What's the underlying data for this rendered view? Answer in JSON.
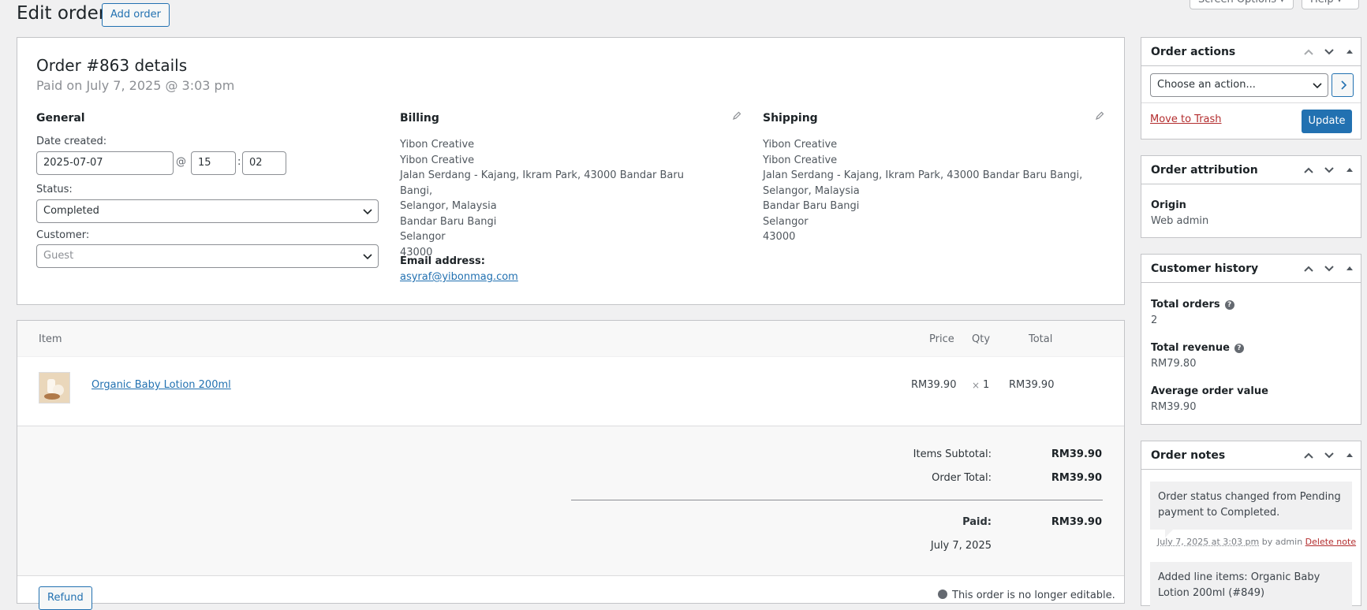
{
  "header": {
    "title": "Edit order",
    "add_order": "Add order",
    "screen_options": "Screen Options ▾",
    "help": "Help ▾"
  },
  "order": {
    "heading": "Order #863 details",
    "paid_on": "Paid on July 7, 2025 @ 3:03 pm",
    "general": {
      "title": "General",
      "date_label": "Date created:",
      "date_value": "2025-07-07",
      "at": "@",
      "hour": "15",
      "colon": ":",
      "minute": "02",
      "status_label": "Status:",
      "status_value": "Completed",
      "customer_label": "Customer:",
      "customer_value": "Guest"
    },
    "billing": {
      "title": "Billing",
      "lines": [
        "Yibon Creative",
        "Yibon Creative",
        "Jalan Serdang - Kajang, Ikram Park, 43000 Bandar Baru Bangi,",
        "Selangor, Malaysia",
        "Bandar Baru Bangi",
        "Selangor",
        "43000"
      ],
      "email_label": "Email address:",
      "email": "asyraf@yibonmag.com"
    },
    "shipping": {
      "title": "Shipping",
      "lines": [
        "Yibon Creative",
        "Yibon Creative",
        "Jalan Serdang - Kajang, Ikram Park, 43000 Bandar Baru Bangi,",
        "Selangor, Malaysia",
        "Bandar Baru Bangi",
        "Selangor",
        "43000"
      ]
    }
  },
  "items": {
    "headers": {
      "item": "Item",
      "price": "Price",
      "qty": "Qty",
      "total": "Total"
    },
    "rows": [
      {
        "name": "Organic Baby Lotion 200ml",
        "price": "RM39.90",
        "times": "×",
        "qty": "1",
        "total": "RM39.90"
      }
    ],
    "totals": {
      "subtotal_label": "Items Subtotal:",
      "subtotal": "RM39.90",
      "order_total_label": "Order Total:",
      "order_total": "RM39.90",
      "paid_label": "Paid:",
      "paid": "RM39.90",
      "paid_date": "July 7, 2025"
    },
    "refund": "Refund",
    "not_editable": "This order is no longer editable."
  },
  "sidebar": {
    "actions": {
      "title": "Order actions",
      "choose": "Choose an action...",
      "trash": "Move to Trash",
      "update": "Update"
    },
    "attribution": {
      "title": "Order attribution",
      "origin_label": "Origin",
      "origin_value": "Web admin"
    },
    "history": {
      "title": "Customer history",
      "total_orders_label": "Total orders",
      "total_orders": "2",
      "total_revenue_label": "Total revenue",
      "total_revenue": "RM79.80",
      "avg_label": "Average order value",
      "avg": "RM39.90"
    },
    "notes": {
      "title": "Order notes",
      "note1": "Order status changed from Pending payment to Completed.",
      "note1_date": "July 7, 2025 at 3:03 pm",
      "note1_by": " by admin ",
      "delete": "Delete note",
      "note2": "Added line items: Organic Baby Lotion 200ml (#849)"
    }
  },
  "colors": {
    "accent": "#2271b1",
    "danger": "#b32d2e"
  }
}
